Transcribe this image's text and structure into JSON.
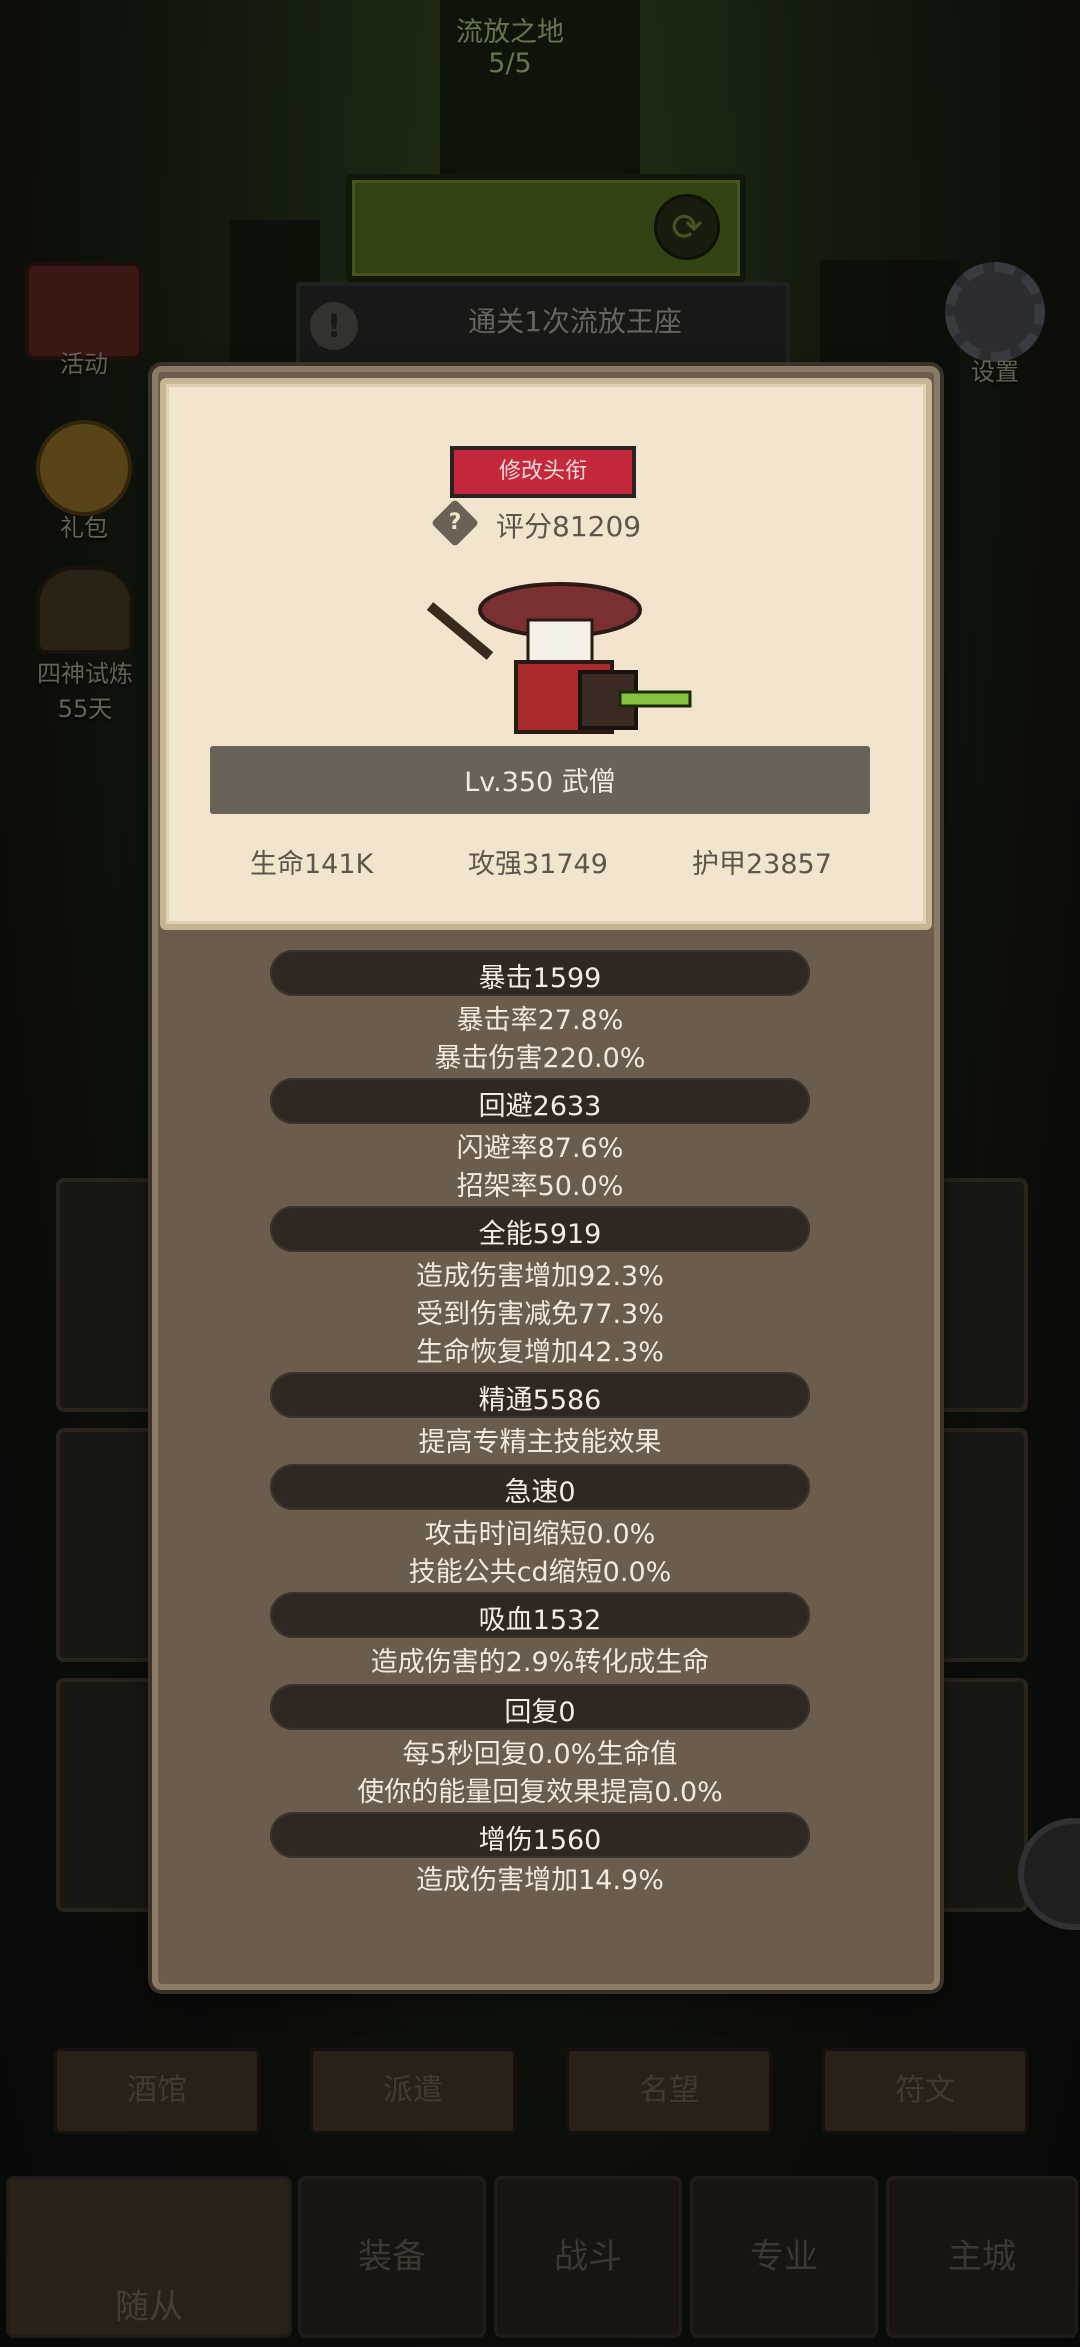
{
  "stage": {
    "name": "流放之地",
    "progress": "5/5"
  },
  "quest": {
    "text": "通关1次流放王座"
  },
  "side_left": [
    {
      "label": "活动"
    },
    {
      "label": "礼包"
    },
    {
      "label": "四神试炼",
      "sub": "55天"
    }
  ],
  "side_right": {
    "label": "设置"
  },
  "hero_card": {
    "title_button": "修改头衔",
    "score": "评分81209",
    "level_class": "Lv.350 武僧",
    "core_stats": [
      "生命141K",
      "攻强31749",
      "护甲23857"
    ]
  },
  "stats": [
    {
      "title": "暴击1599",
      "lines": [
        "暴击率27.8%",
        "暴击伤害220.0%"
      ]
    },
    {
      "title": "回避2633",
      "lines": [
        "闪避率87.6%",
        "招架率50.0%"
      ]
    },
    {
      "title": "全能5919",
      "lines": [
        "造成伤害增加92.3%",
        "受到伤害减免77.3%",
        "生命恢复增加42.3%"
      ]
    },
    {
      "title": "精通5586",
      "lines": [
        "提高专精主技能效果"
      ]
    },
    {
      "title": "急速0",
      "lines": [
        "攻击时间缩短0.0%",
        "技能公共cd缩短0.0%"
      ]
    },
    {
      "title": "吸血1532",
      "lines": [
        "造成伤害的2.9%转化成生命"
      ]
    },
    {
      "title": "回复0",
      "lines": [
        "每5秒回复0.0%生命值",
        "使你的能量回复效果提高0.0%"
      ]
    },
    {
      "title": "增伤1560",
      "lines": [
        "造成伤害增加14.9%"
      ]
    }
  ],
  "tabs": [
    "酒馆",
    "派遣",
    "名望",
    "符文"
  ],
  "nav": [
    "随从",
    "装备",
    "战斗",
    "专业",
    "主城"
  ]
}
